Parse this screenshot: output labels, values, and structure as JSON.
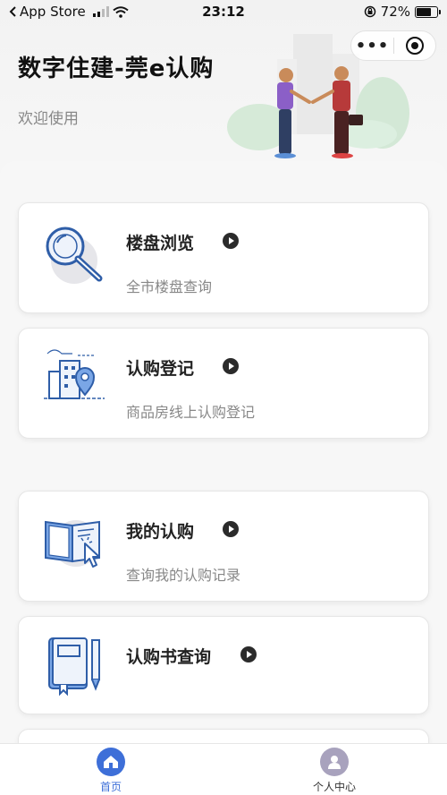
{
  "status_bar": {
    "back_app": "App Store",
    "time": "23:12",
    "battery": "72%",
    "battery_level": 0.72
  },
  "header": {
    "title": "数字住建-莞e认购",
    "subtitle": "欢迎使用",
    "more_label": "•••"
  },
  "cards": [
    {
      "title": "楼盘浏览",
      "subtitle": "全市楼盘查询",
      "icon": "magnifier-icon"
    },
    {
      "title": "认购登记",
      "subtitle": "商品房线上认购登记",
      "icon": "building-location-icon"
    },
    {
      "title": "我的认购",
      "subtitle": "查询我的认购记录",
      "icon": "book-cursor-icon"
    },
    {
      "title": "认购书查询",
      "subtitle": "",
      "icon": "document-pencil-icon"
    }
  ],
  "tabbar": {
    "tabs": [
      {
        "label": "首页",
        "active": true,
        "icon": "home-icon"
      },
      {
        "label": "个人中心",
        "active": false,
        "icon": "user-icon"
      }
    ]
  },
  "colors": {
    "accent": "#3e6fd8",
    "text_primary": "#222222",
    "text_secondary": "#888888",
    "icon_blue": "#2f5ea8"
  }
}
